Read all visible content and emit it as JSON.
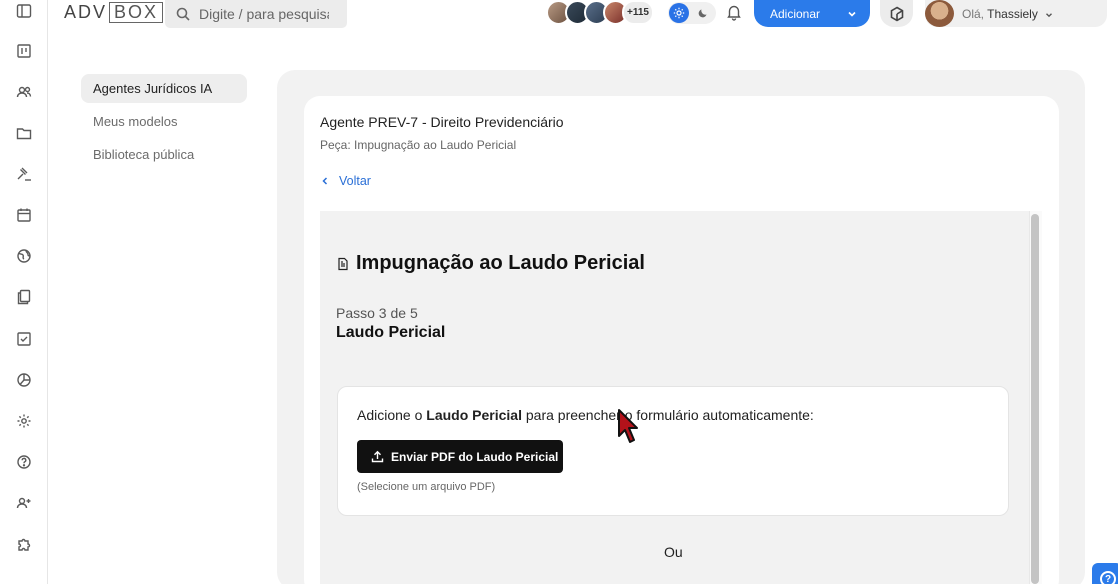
{
  "topbar": {
    "logo_left": "ADV",
    "logo_box": "BOX",
    "search_placeholder": "Digite / para pesquisar",
    "avatar_overflow": "+115",
    "add_button": "Adicionar",
    "user_greeting": "Olá,",
    "user_name": "Thassiely"
  },
  "subnav": {
    "items": [
      {
        "label": "Agentes Jurídicos IA",
        "active": true
      },
      {
        "label": "Meus modelos",
        "active": false
      },
      {
        "label": "Biblioteca pública",
        "active": false
      }
    ]
  },
  "agent": {
    "title": "Agente PREV-7 - Direito Previdenciário",
    "subtitle": "Peça: Impugnação ao Laudo Pericial",
    "back_label": "Voltar"
  },
  "document": {
    "title": "Impugnação ao Laudo Pericial",
    "step": "Passo 3 de 5",
    "step_name": "Laudo Pericial",
    "upload_prefix": "Adicione o ",
    "upload_bold": "Laudo Pericial",
    "upload_suffix": " para preencher o formulário automaticamente:",
    "upload_button": "Enviar PDF do Laudo Pericial",
    "upload_hint": "(Selecione um arquivo PDF)",
    "divider_text": "Ou"
  },
  "help_fab": "?",
  "colors": {
    "accent": "#2b7bea",
    "link": "#2a6fd6",
    "panel": "#f2f2f2",
    "primary_button": "#111111"
  },
  "icons": {
    "rail": [
      "sidebar-toggle-icon",
      "board-icon",
      "contacts-icon",
      "folder-icon",
      "gavel-icon",
      "calendar-icon",
      "globe-icon",
      "documents-icon",
      "task-check-icon",
      "pie-chart-icon",
      "settings-icon",
      "help-icon",
      "add-user-icon",
      "puzzle-icon"
    ]
  }
}
